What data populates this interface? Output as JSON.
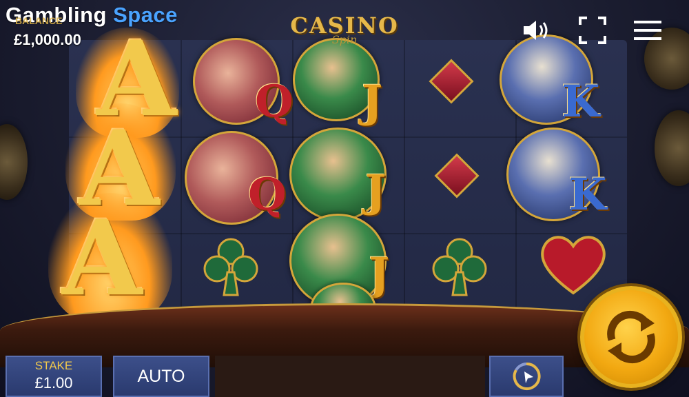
{
  "header": {
    "brand_part1": "Gambling ",
    "brand_part2": "Space",
    "balance_label": "BALANCE",
    "balance_value": "£1,000.00"
  },
  "logo": {
    "main": "CASINO",
    "sub": "Spin"
  },
  "controls": {
    "stake_label": "STAKE",
    "stake_value": "£1.00",
    "auto_label": "AUTO"
  },
  "reels": {
    "reel1": [
      "A",
      "A",
      "A"
    ],
    "reel2": [
      "Q",
      "Q",
      "club"
    ],
    "reel3": [
      "J",
      "J",
      "J"
    ],
    "reel4": [
      "diamond",
      "diamond",
      "club"
    ],
    "reel5": [
      "K",
      "K",
      "heart"
    ]
  },
  "symbol_letters": {
    "ace": "A",
    "queen": "Q",
    "jack": "J",
    "king": "K"
  },
  "colors": {
    "brand_accent": "#4aa3ff",
    "spin_button": "#f2a811",
    "control_bg": "#2a3a6e",
    "gold": "#e6b84a"
  },
  "icons": {
    "sound": "speaker-icon",
    "fullscreen": "fullscreen-icon",
    "menu": "hamburger-menu-icon",
    "turbo": "turbo-speed-icon",
    "spin": "spin-arrows-icon"
  }
}
